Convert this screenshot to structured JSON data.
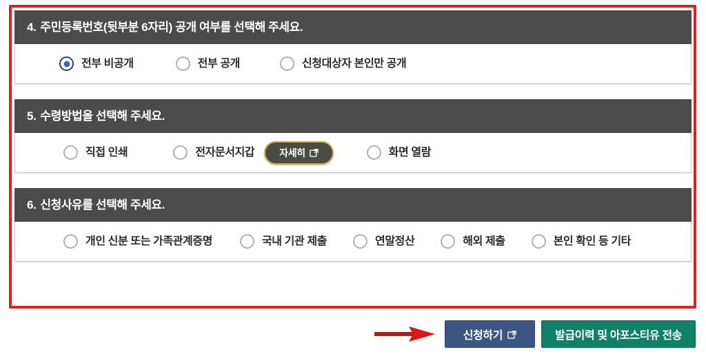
{
  "sections": [
    {
      "number": "4.",
      "title": "주민등록번호(뒷부분 6자리) 공개 여부를 선택해 주세요.",
      "options": [
        {
          "label": "전부 비공개",
          "checked": true
        },
        {
          "label": "전부 공개",
          "checked": false
        },
        {
          "label": "신청대상자 본인만 공개",
          "checked": false
        }
      ]
    },
    {
      "number": "5.",
      "title": "수령방법을 선택해 주세요.",
      "options": [
        {
          "label": "직접 인쇄",
          "checked": false
        },
        {
          "label": "전자문서지갑",
          "checked": false
        },
        {
          "label": "화면 열람",
          "checked": false
        }
      ],
      "detail_button": {
        "label": "자세히",
        "icon": "external-link-icon",
        "border_color": "#c6ac5d",
        "background_color": "#4b4b46"
      }
    },
    {
      "number": "6.",
      "title": "신청사유를 선택해 주세요.",
      "options": [
        {
          "label": "개인 신분 또는 가족관계증명",
          "checked": false
        },
        {
          "label": "국내 기관 제출",
          "checked": false
        },
        {
          "label": "연말정산",
          "checked": false
        },
        {
          "label": "해외 제출",
          "checked": false
        },
        {
          "label": "본인 확인 등 기타",
          "checked": false
        }
      ]
    }
  ],
  "actions": {
    "pointer_arrow": {
      "icon": "right-arrow-annotation",
      "color": "#d81f1f"
    },
    "apply_button": {
      "label": "신청하기",
      "icon": "external-link-icon",
      "color": "#3c5684"
    },
    "history_button": {
      "label": "발급이력 및 아포스티유 전송",
      "color": "#108066"
    }
  },
  "annotation": {
    "frame_color": "#e02020"
  },
  "theme": {
    "header_bar": "#4b4b4b",
    "body_background": "#ffffff",
    "radio_checked": "#3864b4",
    "radio_ring": "#2b3d72",
    "radio_unchecked": "#b0b0b0"
  }
}
